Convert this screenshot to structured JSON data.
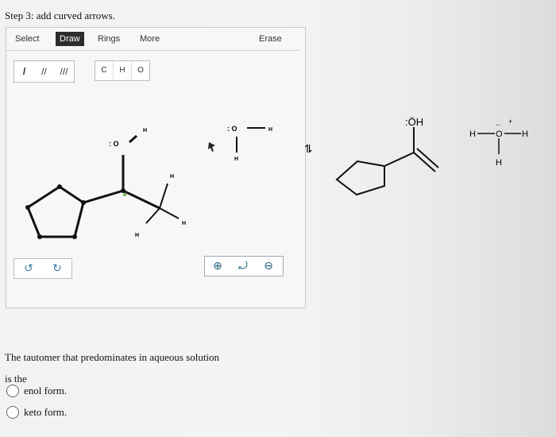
{
  "step_title": "Step 3: add curved arrows.",
  "toolbar": {
    "tabs": [
      {
        "label": "Select",
        "active": false
      },
      {
        "label": "Draw",
        "active": true
      },
      {
        "label": "Rings",
        "active": false
      },
      {
        "label": "More",
        "active": false
      }
    ],
    "erase_label": "Erase"
  },
  "bond_tools": [
    "/",
    "//",
    "///"
  ],
  "atom_tools": [
    "C",
    "H",
    "O"
  ],
  "canvas": {
    "oxygen_label": ": O",
    "h_on_o": "H",
    "h_right_top": "H",
    "h_right_bottom": "H",
    "h_bottom": "H",
    "water_o": ": O",
    "water_h_right": "H",
    "water_h_bottom": "H"
  },
  "undo_icons": [
    "undo-icon",
    "redo-icon"
  ],
  "zoom_icons": [
    "zoom-in-icon",
    "reset-zoom-icon",
    "zoom-out-icon"
  ],
  "equation": {
    "oh_label": ":ÖH",
    "hydronium_h_left": "H",
    "hydronium_o": "O",
    "hydronium_h_right": "H",
    "hydronium_h_bottom": "H",
    "hydronium_charge": "+",
    "hydronium_lone_pair": "..",
    "equilibrium_symbol": "⇌"
  },
  "question": {
    "line1": "The tautomer that predominates in aqueous solution",
    "line2": "is the",
    "options": [
      {
        "label": "enol form.",
        "selected": false
      },
      {
        "label": "keto form.",
        "selected": false
      }
    ]
  }
}
